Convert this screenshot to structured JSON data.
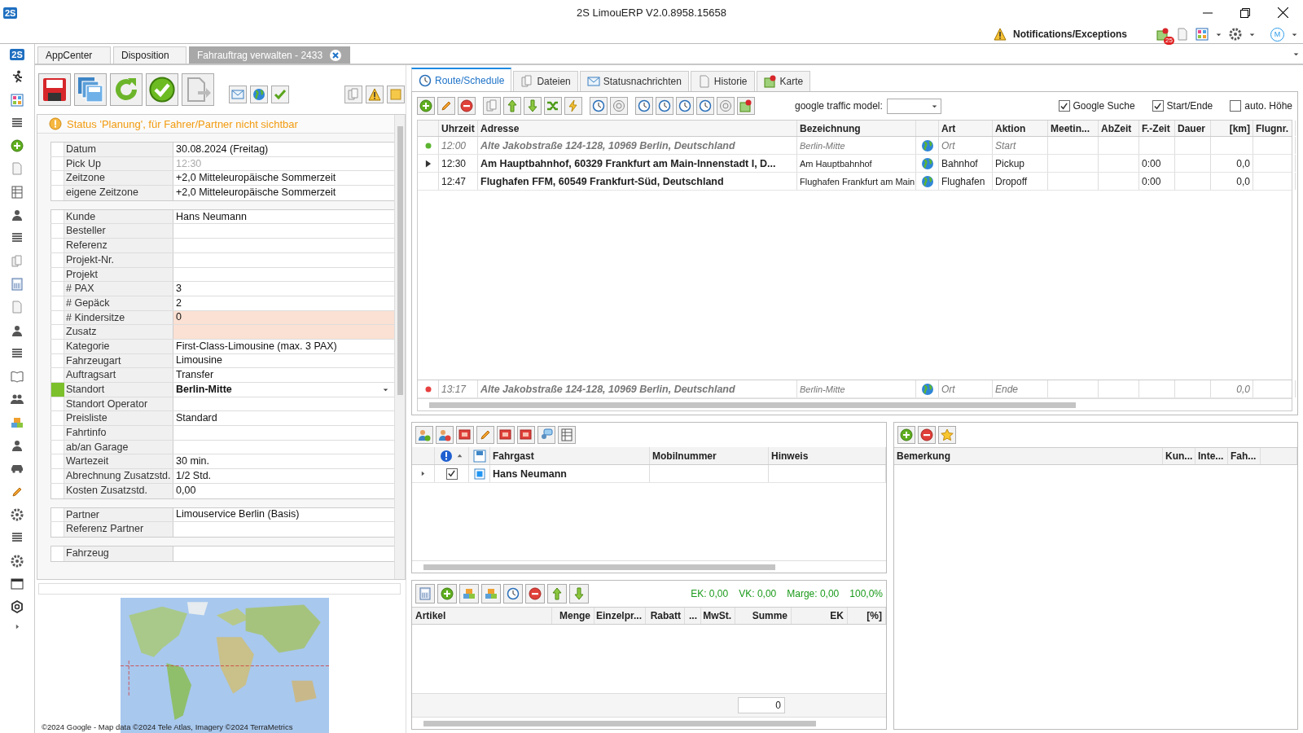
{
  "window": {
    "logo": "2S",
    "title": "2S LimouERP V2.0.8958.15658"
  },
  "header": {
    "notifications": "Notifications/Exceptions",
    "badge": "25",
    "user_initial": "M"
  },
  "sidebar": {
    "logo": "2S"
  },
  "tabs": [
    {
      "label": "AppCenter",
      "selected": false
    },
    {
      "label": "Disposition",
      "selected": false
    },
    {
      "label": "Fahrauftrag verwalten - 2433",
      "selected": true
    }
  ],
  "order_form": {
    "status": "Status 'Planung', für Fahrer/Partner nicht sichtbar",
    "groups": [
      [
        {
          "label": "Datum",
          "value": "30.08.2024 (Freitag)",
          "kind": "text",
          "disabled": false,
          "highlighted": false
        },
        {
          "label": "Pick Up",
          "placeholder": "12:30",
          "kind": "text",
          "disabled": false,
          "highlighted": false
        },
        {
          "label": "Zeitzone",
          "value": "+2,0 Mitteleuropäische Sommerzeit",
          "kind": "text",
          "disabled": false,
          "highlighted": false
        },
        {
          "label": "eigene Zeitzone",
          "value": "+2,0 Mitteleuropäische Sommerzeit",
          "kind": "text",
          "disabled": false,
          "highlighted": false
        }
      ],
      [
        {
          "label": "Kunde",
          "value": "Hans Neumann",
          "kind": "text",
          "disabled": false,
          "highlighted": false
        },
        {
          "label": "Besteller",
          "kind": "text",
          "disabled": false,
          "highlighted": false
        },
        {
          "label": "Referenz",
          "kind": "text",
          "disabled": false,
          "highlighted": false
        },
        {
          "label": "Projekt-Nr.",
          "kind": "text",
          "disabled": false,
          "highlighted": false
        },
        {
          "label": "Projekt",
          "kind": "text",
          "disabled": false,
          "highlighted": false
        },
        {
          "label": "# PAX",
          "value": "3",
          "kind": "text",
          "disabled": false,
          "highlighted": false
        },
        {
          "label": "# Gepäck",
          "value": "2",
          "kind": "text",
          "disabled": false,
          "highlighted": false
        },
        {
          "label": "# Kindersitze",
          "value": "0",
          "kind": "text",
          "disabled": false,
          "highlighted": true
        },
        {
          "label": "Zusatz",
          "kind": "text",
          "disabled": false,
          "highlighted": true
        },
        {
          "label": "Kategorie",
          "value": "First-Class-Limousine (max. 3 PAX)",
          "kind": "text",
          "disabled": false,
          "highlighted": false
        },
        {
          "label": "Fahrzeugart",
          "value": "Limousine",
          "kind": "text",
          "disabled": false,
          "highlighted": false
        },
        {
          "label": "Auftragsart",
          "value": "Transfer",
          "kind": "text",
          "disabled": false,
          "highlighted": false
        },
        {
          "label": "Standort",
          "value": "Berlin-Mitte",
          "kind": "dropdown",
          "disabled": false,
          "highlighted": false
        },
        {
          "label": "Standort Operator",
          "kind": "text",
          "disabled": false,
          "highlighted": false
        },
        {
          "label": "Preisliste",
          "value": "Standard",
          "kind": "text",
          "disabled": false,
          "highlighted": false
        },
        {
          "label": "Fahrtinfo",
          "kind": "text",
          "disabled": false,
          "highlighted": false
        },
        {
          "label": "ab/an Garage",
          "kind": "text",
          "disabled": false,
          "highlighted": false
        },
        {
          "label": "Wartezeit",
          "value": "30 min.",
          "kind": "text",
          "disabled": false,
          "highlighted": false
        },
        {
          "label": "Abrechnung Zusatzstd.",
          "value": "1/2 Std.",
          "kind": "text",
          "disabled": false,
          "highlighted": false
        },
        {
          "label": "Kosten Zusatzstd.",
          "value": "0,00",
          "kind": "text",
          "disabled": false,
          "highlighted": false
        }
      ],
      [
        {
          "label": "Partner",
          "value": "Limouservice Berlin (Basis)",
          "kind": "text",
          "disabled": false,
          "highlighted": false
        },
        {
          "label": "Referenz Partner",
          "kind": "text",
          "disabled": false,
          "highlighted": false
        }
      ],
      [
        {
          "label": "Fahrzeug",
          "kind": "text",
          "disabled": false,
          "highlighted": false
        }
      ]
    ]
  },
  "map": {
    "attribution": "©2024 Google - Map data ©2024 Tele Atlas, Imagery ©2024 TerraMetrics"
  },
  "detail_tabs": [
    {
      "label": "Route/Schedule",
      "selected": true
    },
    {
      "label": "Dateien",
      "selected": false
    },
    {
      "label": "Statusnachrichten",
      "selected": false
    },
    {
      "label": "Historie",
      "selected": false
    },
    {
      "label": "Karte",
      "selected": false
    }
  ],
  "route": {
    "traffic_label": "google traffic model:",
    "options": [
      {
        "label": "Google Suche",
        "checked": true
      },
      {
        "label": "Start/Ende",
        "checked": true
      },
      {
        "label": "auto. Höhe",
        "checked": false
      }
    ],
    "columns": [
      "Uhrzeit",
      "Adresse",
      "Bezeichnung",
      "Art",
      "Aktion",
      "Meetin...",
      "AbZeit",
      "F.-Zeit",
      "Dauer",
      "[km]",
      "Flugnr."
    ],
    "rows": [
      {
        "kind": "start",
        "current": false,
        "time": "12:00",
        "address": "Alte Jakobstraße 124-128, 10969 Berlin, Deutschland",
        "name": "Berlin-Mitte",
        "type": "Ort",
        "action": "Start"
      },
      {
        "kind": "stop",
        "current": true,
        "time": "12:30",
        "address": "Am Hauptbahnhof, 60329 Frankfurt am Main-Innenstadt I, D...",
        "name": "Am Hauptbahnhof",
        "type": "Bahnhof",
        "action": "Pickup",
        "f_time": "0:00",
        "km": "0,0"
      },
      {
        "kind": "stop",
        "current": false,
        "time": "12:47",
        "address": "Flughafen FFM, 60549 Frankfurt-Süd, Deutschland",
        "name": "Flughafen Frankfurt am Main",
        "type": "Flughafen",
        "action": "Dropoff",
        "f_time": "0:00",
        "km": "0,0"
      }
    ],
    "end_row": {
      "kind": "end",
      "current": false,
      "time": "13:17",
      "address": "Alte Jakobstraße 124-128, 10969 Berlin, Deutschland",
      "name": "Berlin-Mitte",
      "type": "Ort",
      "action": "Ende",
      "km": "0,0"
    }
  },
  "passengers": {
    "columns": [
      "Fahrgast",
      "Mobilnummer",
      "Hinweis"
    ],
    "rows": [
      {
        "name": "Hans Neumann",
        "checked": true,
        "current": true
      }
    ]
  },
  "articles": {
    "totals": [
      "EK: 0,00",
      "VK: 0,00",
      "Marge: 0,00",
      "100,0%"
    ],
    "columns": [
      "Artikel",
      "Menge",
      "Einzelpr...",
      "Rabatt",
      "...",
      "MwSt.",
      "Summe",
      "EK",
      "[%]"
    ],
    "count": "0"
  },
  "remarks": {
    "columns": [
      "Bemerkung",
      "Kun...",
      "Inte...",
      "Fah..."
    ]
  }
}
